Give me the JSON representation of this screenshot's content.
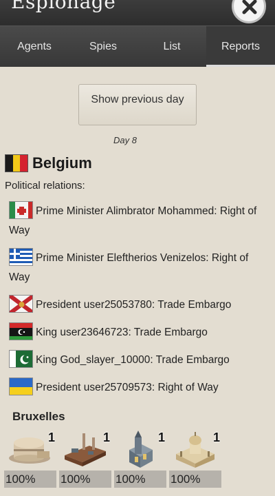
{
  "header": {
    "title": "Espionage"
  },
  "tabs": [
    {
      "label": "Agents"
    },
    {
      "label": "Spies"
    },
    {
      "label": "List"
    },
    {
      "label": "Reports"
    }
  ],
  "active_tab": "Reports",
  "report": {
    "prev_day_label": "Show previous day",
    "day_label": "Day 8",
    "country": "Belgium",
    "political_label": "Political relations:",
    "relations": [
      {
        "flag": "flag-red-white-cross-icon",
        "text": "Prime Minister Alimbrator Mohammed: Right of Way"
      },
      {
        "flag": "greece-flag-icon",
        "text": "Prime Minister Eleftherios Venizelos: Right of Way"
      },
      {
        "flag": "saltire-flag-icon",
        "text": "President user25053780: Trade Embargo"
      },
      {
        "flag": "libya-flag-icon",
        "text": "King user23646723: Trade Embargo"
      },
      {
        "flag": "pakistan-flag-icon",
        "text": "King God_slayer_10000: Trade Embargo"
      },
      {
        "flag": "ukraine-flag-icon",
        "text": "President user25709573: Right of Way"
      }
    ],
    "city": "Bruxelles",
    "buildings": [
      {
        "icon": "bunker-icon",
        "count": "1",
        "percent": "100%"
      },
      {
        "icon": "factory-icon",
        "count": "1",
        "percent": "100%"
      },
      {
        "icon": "church-icon",
        "count": "1",
        "percent": "100%"
      },
      {
        "icon": "palace-icon",
        "count": "1",
        "percent": "100%"
      }
    ]
  }
}
